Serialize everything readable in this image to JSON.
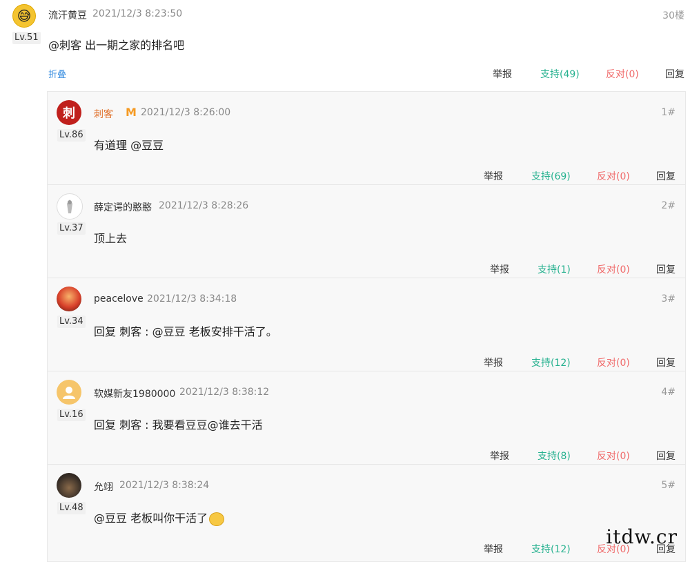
{
  "main": {
    "username": "流汗黄豆",
    "time": "2021/12/3 8:23:50",
    "floor": "30楼",
    "level": "Lv.51",
    "content": "@刺客 出一期之家的排名吧",
    "fold": "折叠",
    "report": "举报",
    "support": "支持(49)",
    "oppose": "反对(0)",
    "reply": "回复"
  },
  "replies": [
    {
      "username": "刺客",
      "badge": "M",
      "avatar": "刺",
      "time": "2021/12/3 8:26:00",
      "floor": "1#",
      "level": "Lv.86",
      "content": "有道理 @豆豆",
      "report": "举报",
      "support": "支持(69)",
      "oppose": "反对(0)",
      "reply": "回复"
    },
    {
      "username": "薛定谔的憨憨",
      "time": "2021/12/3 8:28:26",
      "floor": "2#",
      "level": "Lv.37",
      "content": "顶上去",
      "report": "举报",
      "support": "支持(1)",
      "oppose": "反对(0)",
      "reply": "回复"
    },
    {
      "username": "peacelove",
      "time": "2021/12/3 8:34:18",
      "floor": "3#",
      "level": "Lv.34",
      "content": "回复 刺客 : @豆豆 老板安排干活了。",
      "report": "举报",
      "support": "支持(12)",
      "oppose": "反对(0)",
      "reply": "回复"
    },
    {
      "username": "软媒新友1980000",
      "time": "2021/12/3 8:38:12",
      "floor": "4#",
      "level": "Lv.16",
      "content": "回复 刺客 : 我要看豆豆@谁去干活",
      "report": "举报",
      "support": "支持(8)",
      "oppose": "反对(0)",
      "reply": "回复"
    },
    {
      "username": "允翊",
      "time": "2021/12/3 8:38:24",
      "floor": "5#",
      "level": "Lv.48",
      "content": "@豆豆 老板叫你干活了",
      "report": "举报",
      "support": "支持(12)",
      "oppose": "反对(0)",
      "reply": "回复"
    }
  ],
  "watermark": "itdw.cr",
  "colors": {
    "support": "#26b18f",
    "oppose": "#f06a6a",
    "link": "#3b8fe0",
    "vip": "#f59a23"
  }
}
